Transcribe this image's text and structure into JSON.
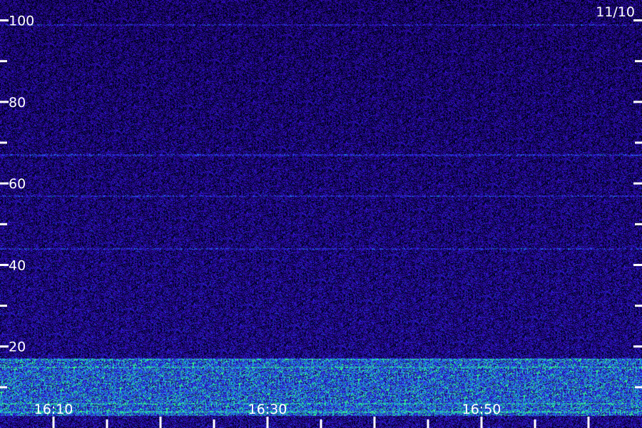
{
  "chart_data": {
    "type": "heatmap",
    "title": "",
    "date_label": "11/10",
    "xlabel": "",
    "ylabel": "",
    "x_range": [
      "16:05",
      "17:05"
    ],
    "x_tick_labels": [
      "16:10",
      "16:30",
      "16:50"
    ],
    "x_minor_tick_every_minutes": 5,
    "y_range": [
      0,
      105
    ],
    "y_tick_labels": [
      "100",
      "80",
      "60",
      "40",
      "20"
    ],
    "y_major_ticks": [
      100,
      80,
      60,
      40,
      20
    ],
    "y_minor_ticks": [
      90,
      70,
      50,
      30,
      10
    ],
    "grid": false,
    "colormap": [
      "#000000",
      "#1a0a5a",
      "#2a14b0",
      "#3a3aff",
      "#18c8c8",
      "#40ff80"
    ],
    "features": {
      "low_band_intense": [
        3,
        17
      ],
      "persistent_lines": [
        99,
        67,
        57,
        44,
        17,
        15,
        6,
        4
      ]
    }
  }
}
